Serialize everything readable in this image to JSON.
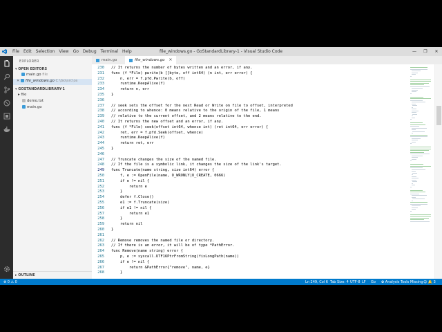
{
  "window": {
    "title": "file_windows.go - GoStandardLibrary-1 - Visual Studio Code",
    "menu": [
      "File",
      "Edit",
      "Selection",
      "View",
      "Go",
      "Debug",
      "Terminal",
      "Help"
    ],
    "controls": [
      "—",
      "❐",
      "✕"
    ]
  },
  "sidebar": {
    "title": "EXPLORER",
    "open_editors_header": "OPEN EDITORS",
    "open_editors": [
      {
        "name": "main.go",
        "detail": "file"
      },
      {
        "name": "file_windows.go",
        "detail": "C:\\Go\\src\\os"
      }
    ],
    "project_header": "GOSTANDARDLIBRARY-1",
    "tree": [
      {
        "name": "file",
        "type": "folder"
      },
      {
        "name": "demo.txt",
        "type": "file"
      },
      {
        "name": "main.go",
        "type": "go"
      }
    ],
    "outline_header": "OUTLINE"
  },
  "tabs": [
    {
      "label": "main.go",
      "active": false
    },
    {
      "label": "file_windows.go",
      "active": true
    }
  ],
  "editor": {
    "current_line": "249",
    "lines": [
      {
        "n": "230",
        "text": "// It returns the number of bytes written and an error, if any.",
        "comment": true
      },
      {
        "n": "231",
        "text": "func (f *File) pwrite(b []byte, off int64) (n int, err error) {",
        "comment": false
      },
      {
        "n": "232",
        "text": "    n, err = f.pfd.Pwrite(b, off)",
        "comment": false
      },
      {
        "n": "233",
        "text": "    runtime.KeepAlive(f)",
        "comment": false
      },
      {
        "n": "234",
        "text": "    return n, err",
        "comment": false
      },
      {
        "n": "235",
        "text": "}",
        "comment": false
      },
      {
        "n": "236",
        "text": "",
        "comment": false
      },
      {
        "n": "237",
        "text": "// seek sets the offset for the next Read or Write on file to offset, interpreted",
        "comment": true
      },
      {
        "n": "238",
        "text": "// according to whence: 0 means relative to the origin of the file, 1 means",
        "comment": true
      },
      {
        "n": "239",
        "text": "// relative to the current offset, and 2 means relative to the end.",
        "comment": true
      },
      {
        "n": "240",
        "text": "// It returns the new offset and an error, if any.",
        "comment": true
      },
      {
        "n": "241",
        "text": "func (f *File) seek(offset int64, whence int) (ret int64, err error) {",
        "comment": false
      },
      {
        "n": "242",
        "text": "    ret, err = f.pfd.Seek(offset, whence)",
        "comment": false
      },
      {
        "n": "243",
        "text": "    runtime.KeepAlive(f)",
        "comment": false
      },
      {
        "n": "244",
        "text": "    return ret, err",
        "comment": false
      },
      {
        "n": "245",
        "text": "}",
        "comment": false
      },
      {
        "n": "246",
        "text": "",
        "comment": false
      },
      {
        "n": "247",
        "text": "// Truncate changes the size of the named file.",
        "comment": true
      },
      {
        "n": "248",
        "text": "// If the file is a symbolic link, it changes the size of the link's target.",
        "comment": true
      },
      {
        "n": "249",
        "text": "func Truncate(name string, size int64) error {",
        "comment": false
      },
      {
        "n": "250",
        "text": "    f, e := OpenFile(name, O_WRONLY|O_CREATE, 0666)",
        "comment": false
      },
      {
        "n": "251",
        "text": "    if e != nil {",
        "comment": false
      },
      {
        "n": "252",
        "text": "        return e",
        "comment": false
      },
      {
        "n": "253",
        "text": "    }",
        "comment": false
      },
      {
        "n": "254",
        "text": "    defer f.Close()",
        "comment": false
      },
      {
        "n": "255",
        "text": "    e1 := f.Truncate(size)",
        "comment": false
      },
      {
        "n": "256",
        "text": "    if e1 != nil {",
        "comment": false
      },
      {
        "n": "257",
        "text": "        return e1",
        "comment": false
      },
      {
        "n": "258",
        "text": "    }",
        "comment": false
      },
      {
        "n": "259",
        "text": "    return nil",
        "comment": false
      },
      {
        "n": "260",
        "text": "}",
        "comment": false
      },
      {
        "n": "261",
        "text": "",
        "comment": false
      },
      {
        "n": "262",
        "text": "// Remove removes the named file or directory.",
        "comment": true
      },
      {
        "n": "263",
        "text": "// If there is an error, it will be of type *PathError.",
        "comment": true
      },
      {
        "n": "264",
        "text": "func Remove(name string) error {",
        "comment": false
      },
      {
        "n": "265",
        "text": "    p, e := syscall.UTF16PtrFromString(fixLongPath(name))",
        "comment": false
      },
      {
        "n": "266",
        "text": "    if e != nil {",
        "comment": false
      },
      {
        "n": "267",
        "text": "        return &PathError{\"remove\", name, e}",
        "comment": false
      },
      {
        "n": "268",
        "text": "    }",
        "comment": false
      }
    ]
  },
  "statusbar": {
    "left": "⊗ 0 ⚠ 0",
    "position": "Ln 249, Col 6",
    "tabsize": "Tab Size: 4",
    "encoding": "UTF-8",
    "eol": "LF",
    "language": "Go",
    "analysis": "✿ Analysis Tools Missing",
    "notifications": "☺ 🔔 3"
  },
  "colors": {
    "accent": "#007acc",
    "activity_bar": "#2c2c2c",
    "sidebar": "#f3f3f3",
    "comment": "#008000",
    "keyword": "#0000ff"
  }
}
